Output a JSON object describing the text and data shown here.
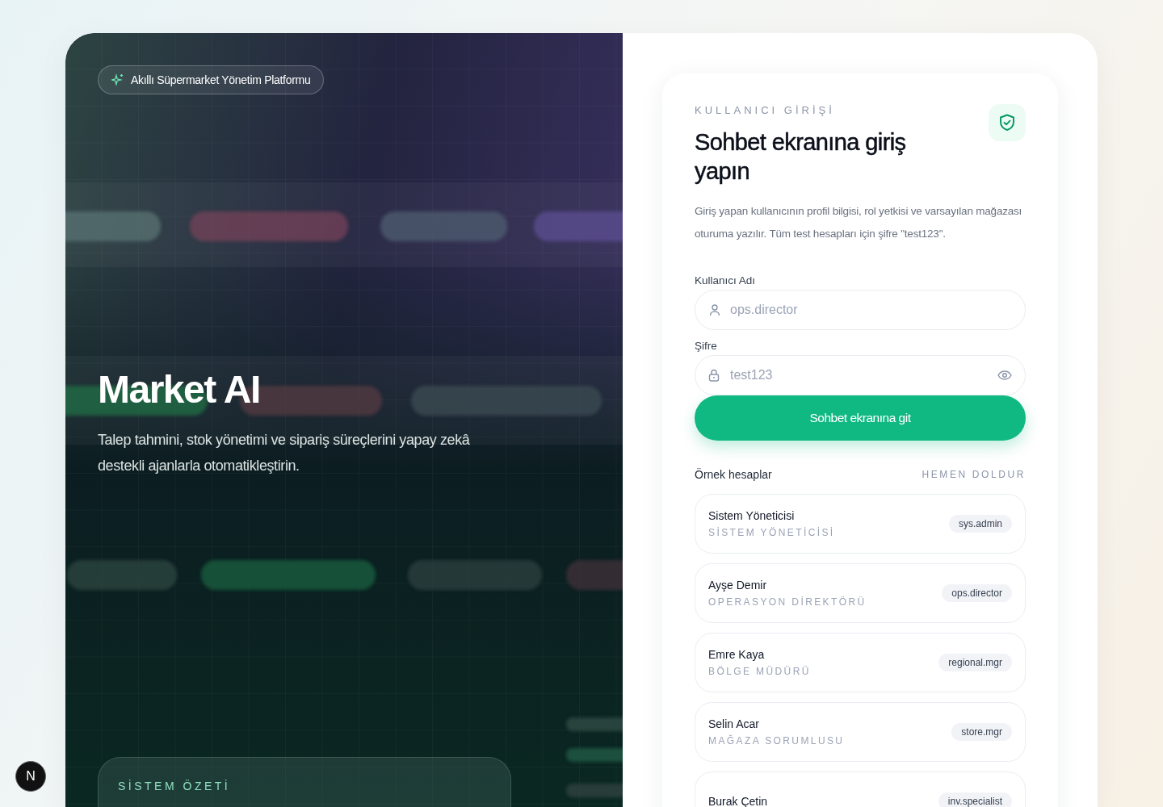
{
  "dev_badge": "N",
  "hero": {
    "badge": "Akıllı Süpermarket Yönetim Platformu",
    "title": "Market AI",
    "subtitle": "Talep tahmini, stok yönetimi ve sipariş süreçlerini yapay zekâ destekli ajanlarla otomatikleştirin.",
    "summary_title": "SİSTEM ÖZETİ"
  },
  "login": {
    "eyebrow": "KULLANICI GİRİŞİ",
    "title": "Sohbet ekranına giriş yapın",
    "description": "Giriş yapan kullanıcının profil bilgisi, rol yetkisi ve varsayılan mağazası oturuma yazılır. Tüm test hesapları için şifre \"test123\".",
    "username": {
      "label": "Kullanıcı Adı",
      "placeholder": "ops.director"
    },
    "password": {
      "label": "Şifre",
      "placeholder": "test123"
    },
    "submit": "Sohbet ekranına git",
    "samples_title": "Örnek hesaplar",
    "fill_link": "HEMEN DOLDUR",
    "accounts": [
      {
        "name": "Sistem Yöneticisi",
        "role": "SİSTEM YÖNETİCİSİ",
        "username": "sys.admin"
      },
      {
        "name": "Ayşe Demir",
        "role": "OPERASYON DİREKTÖRÜ",
        "username": "ops.director"
      },
      {
        "name": "Emre Kaya",
        "role": "BÖLGE MÜDÜRÜ",
        "username": "regional.mgr"
      },
      {
        "name": "Selin Acar",
        "role": "MAĞAZA SORUMLUSU",
        "username": "store.mgr"
      },
      {
        "name": "Burak Çetin",
        "username": "inv.specialist"
      }
    ]
  }
}
